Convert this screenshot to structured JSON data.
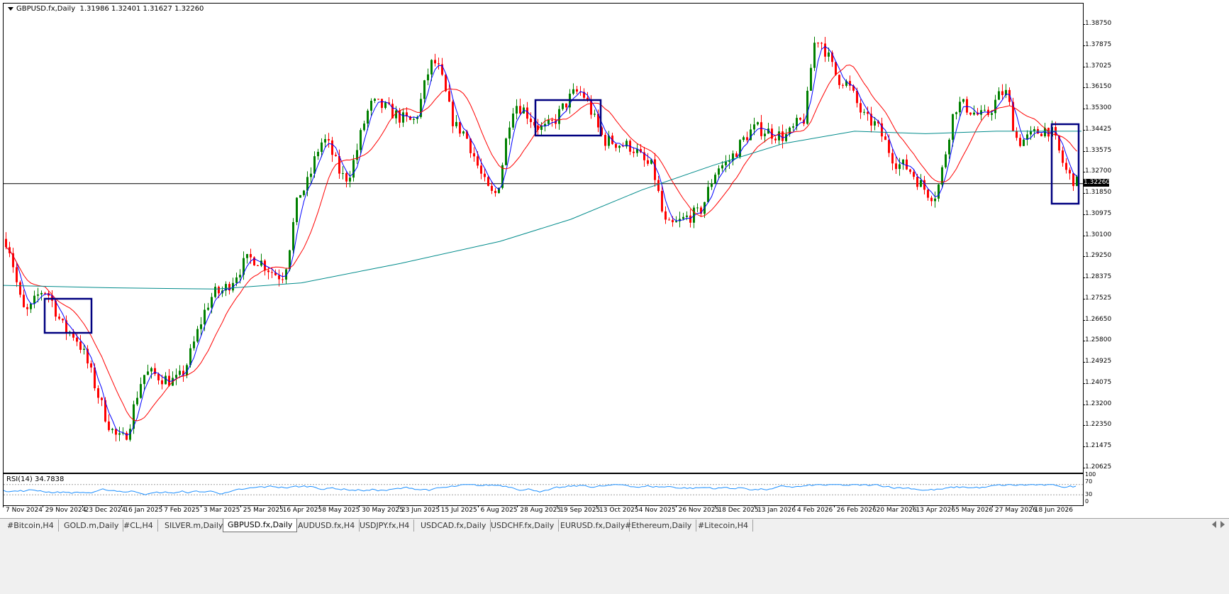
{
  "chart": {
    "symbol_line": "GBPUSD.fx,Daily",
    "ohlc": "1.31986 1.32401 1.31627 1.32260",
    "current_price": "1.32260",
    "price_levels": [
      "1.38750",
      "1.37875",
      "1.37025",
      "1.36150",
      "1.35300",
      "1.34425",
      "1.33575",
      "1.32700",
      "1.31850",
      "1.30975",
      "1.30100",
      "1.29250",
      "1.28375",
      "1.27525",
      "1.26650",
      "1.25800",
      "1.24925",
      "1.24075",
      "1.23200",
      "1.22350",
      "1.21475",
      "1.20625"
    ],
    "colors": {
      "bull": "#008000",
      "bear": "#ff0000",
      "fast_ma": "#0000ff",
      "slow_ma": "#ff0000",
      "long_ma": "#008b8b",
      "box": "#000080",
      "rsi": "#1e90ff"
    }
  },
  "rsi": {
    "label": "RSI(14) 34.7838",
    "levels": [
      "100",
      "70",
      "30",
      "0"
    ]
  },
  "time_axis": [
    "7 Nov 2024",
    "29 Nov 2024",
    "23 Dec 2024",
    "16 Jan 2025",
    "7 Feb 2025",
    "3 Mar 2025",
    "25 Mar 2025",
    "16 Apr 2025",
    "8 May 2025",
    "30 May 2025",
    "23 Jun 2025",
    "15 Jul 2025",
    "6 Aug 2025",
    "28 Aug 2025",
    "19 Sep 2025",
    "13 Oct 2025",
    "4 Nov 2025",
    "26 Nov 2025",
    "18 Dec 2025",
    "13 Jan 2026",
    "4 Feb 2026",
    "26 Feb 2026",
    "20 Mar 2026",
    "13 Apr 2026",
    "5 May 2026",
    "27 May 2026",
    "18 Jun 2026"
  ],
  "tabs": [
    {
      "label": "#Bitcoin,H4",
      "active": false
    },
    {
      "label": "GOLD.m,Daily",
      "active": false
    },
    {
      "label": "#CL,H4",
      "active": false
    },
    {
      "label": "SILVER.m,Daily",
      "active": false
    },
    {
      "label": "GBPUSD.fx,Daily",
      "active": true
    },
    {
      "label": "AUDUSD.fx,H4",
      "active": false
    },
    {
      "label": "USDJPY.fx,H4",
      "active": false
    },
    {
      "label": "USDCAD.fx,Daily",
      "active": false
    },
    {
      "label": "USDCHF.fx,Daily",
      "active": false
    },
    {
      "label": "EURUSD.fx,Daily",
      "active": false
    },
    {
      "label": "#Ethereum,Daily",
      "active": false
    },
    {
      "label": "#Litecoin,H4",
      "active": false
    }
  ]
}
